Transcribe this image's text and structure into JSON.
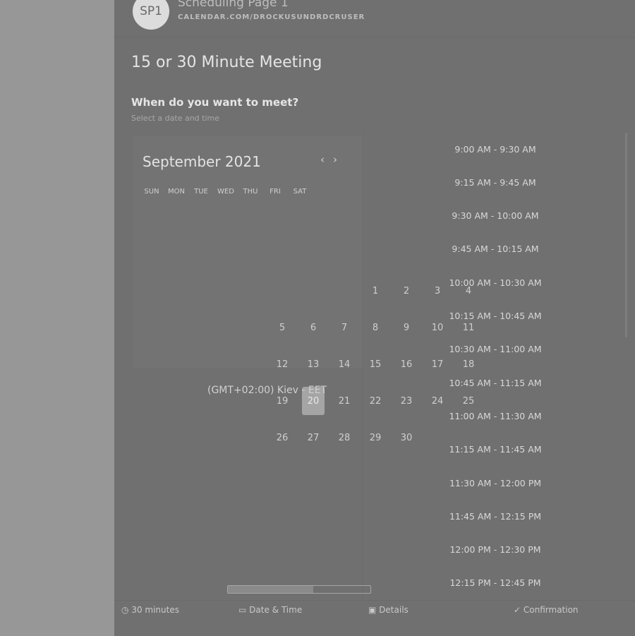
{
  "header": {
    "avatar_text": "SP1",
    "title": "Scheduling Page 1",
    "subtitle": "CALENDAR.COM/DROCKUSUNDRDCRUSER"
  },
  "meeting": {
    "title": "15 or 30 Minute Meeting",
    "question": "When do you want to meet?",
    "hint": "Select a date and time"
  },
  "calendar": {
    "month_label": "September 2021",
    "nav_prev": "‹",
    "nav_next": "›",
    "weekdays": [
      "SUN",
      "MON",
      "TUE",
      "WED",
      "THU",
      "FRI",
      "SAT"
    ],
    "rows": [
      [
        "",
        "",
        "",
        "1",
        "2",
        "3",
        "4"
      ],
      [
        "5",
        "6",
        "7",
        "8",
        "9",
        "10",
        "11"
      ],
      [
        "12",
        "13",
        "14",
        "15",
        "16",
        "17",
        "18"
      ],
      [
        "19",
        "20",
        "21",
        "22",
        "23",
        "24",
        "25"
      ],
      [
        "26",
        "27",
        "28",
        "29",
        "30",
        "",
        ""
      ]
    ],
    "selected_day": "20"
  },
  "timezone": "(GMT+02:00) Kiev - EET",
  "time_slots": [
    "9:00 AM - 9:30 AM",
    "9:15 AM - 9:45 AM",
    "9:30 AM - 10:00 AM",
    "9:45 AM - 10:15 AM",
    "10:00 AM - 10:30 AM",
    "10:15 AM - 10:45 AM",
    "10:30 AM - 11:00 AM",
    "10:45 AM - 11:15 AM",
    "11:00 AM - 11:30 AM",
    "11:15 AM - 11:45 AM",
    "11:30 AM - 12:00 PM",
    "11:45 AM - 12:15 PM",
    "12:00 PM - 12:30 PM",
    "12:15 PM - 12:45 PM"
  ],
  "footer": {
    "items": [
      "30 minutes",
      "Date & Time",
      "Details",
      "Confirmation"
    ]
  }
}
